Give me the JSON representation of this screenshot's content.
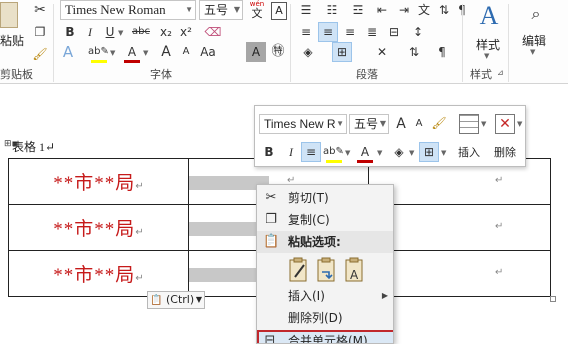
{
  "ribbon": {
    "clipboard": {
      "paste_label": "粘贴",
      "group_label": "剪贴板"
    },
    "font": {
      "font_name": "Times New Roman",
      "font_size": "五号",
      "wen_label": "wén",
      "wen_char": "文",
      "bold": "B",
      "italic": "I",
      "underline": "U",
      "strike": "abc",
      "subscript": "x₂",
      "superscript": "x²",
      "grow": "A",
      "shrink": "A",
      "case": "Aa",
      "char_border": "A",
      "char_shade": "A",
      "group_label": "字体",
      "highlight_color": "#ffff00",
      "font_color": "#c00000"
    },
    "paragraph": {
      "group_label": "段落"
    },
    "styles": {
      "styles_label": "样式",
      "group_label": "样式"
    },
    "editing": {
      "edit_label": "编辑"
    }
  },
  "document": {
    "caption_text": "表格 1↵",
    "rows": [
      {
        "col1": "**市**局",
        "col1_mark": "↵",
        "col2_mark": "↵",
        "col3_mark": "↵"
      },
      {
        "col1": "**市**局",
        "col1_mark": "↵",
        "col2_mark": "↵",
        "col3_mark": "↵"
      },
      {
        "col1": "**市**局",
        "col1_mark": "↵",
        "col2_mark": "↵",
        "col3_mark": "↵"
      }
    ]
  },
  "mini_toolbar": {
    "font_name": "Times New R",
    "font_size": "五号",
    "grow": "A",
    "shrink": "A",
    "bold": "B",
    "italic": "I",
    "insert_label": "插入",
    "delete_label": "删除"
  },
  "context_menu": {
    "cut": "剪切(T)",
    "copy": "复制(C)",
    "paste_options": "粘贴选项:",
    "insert": "插入(I)",
    "delete_column": "删除列(D)",
    "merge_cells": "合并单元格(M)",
    "highlight_color": "#c0282d"
  },
  "paste_tag": {
    "label": "(Ctrl)"
  }
}
